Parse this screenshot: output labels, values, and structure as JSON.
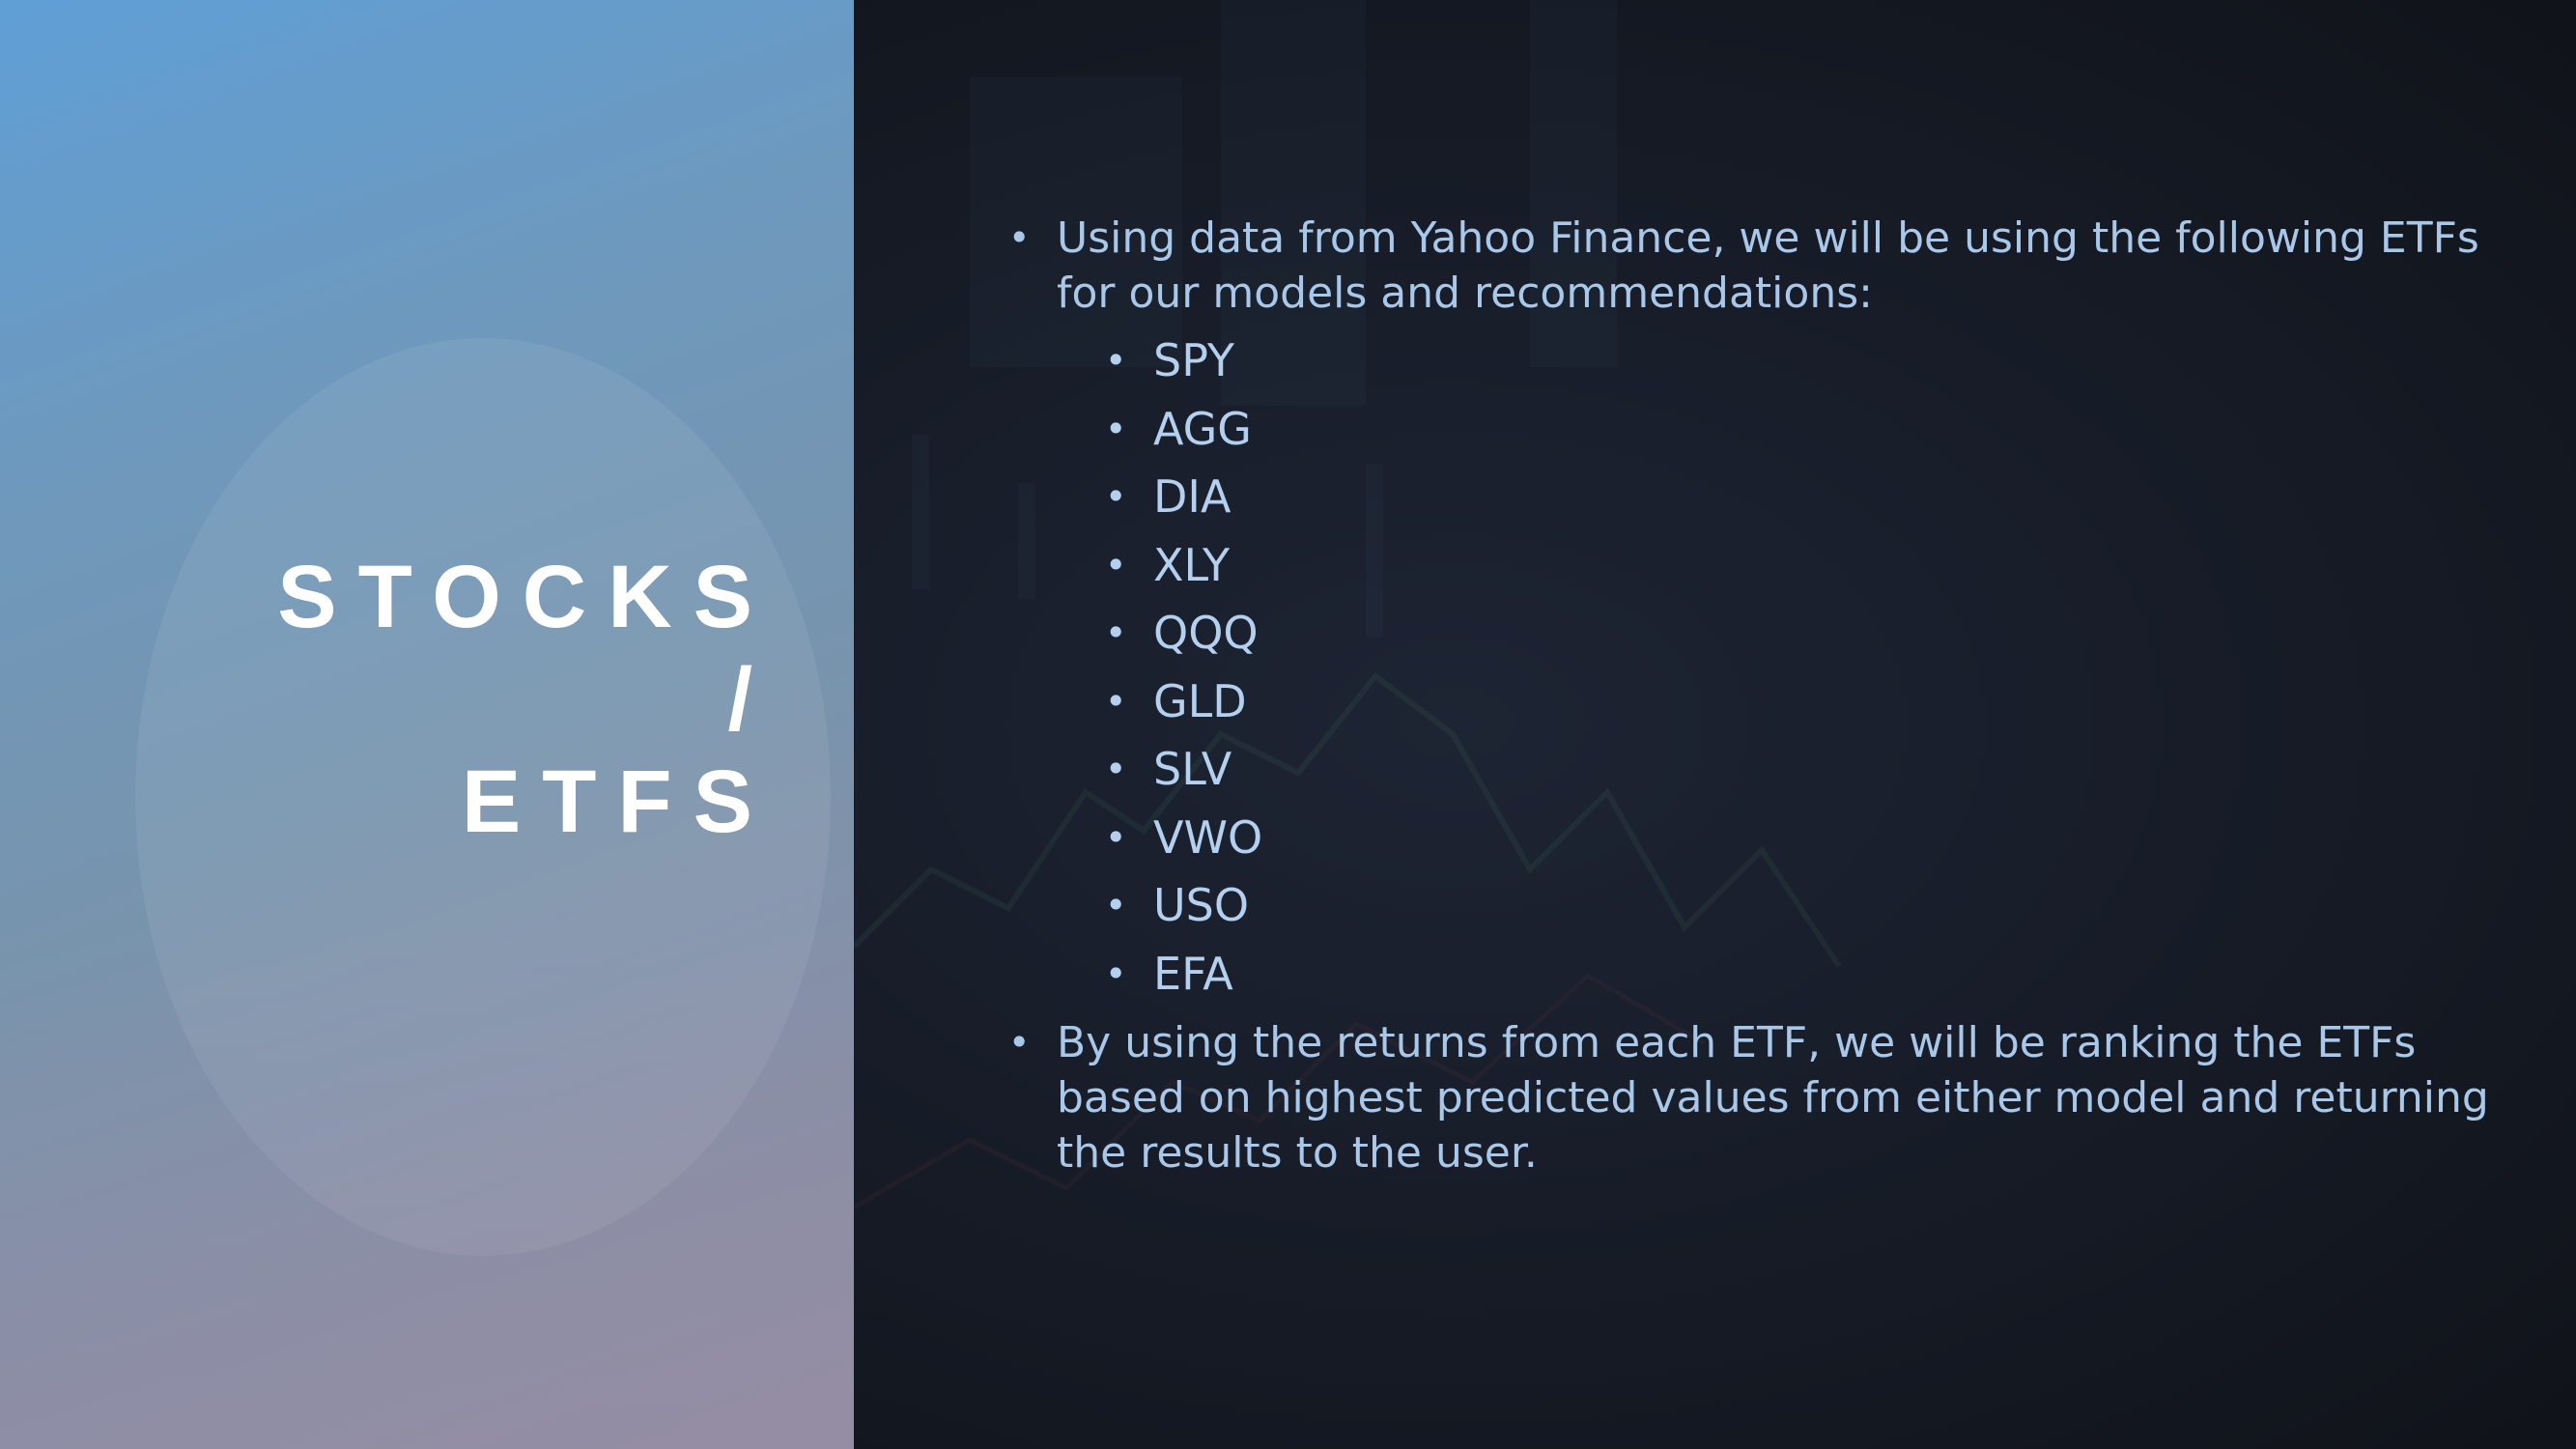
{
  "slide": {
    "title_lines": [
      "STOCKS",
      "/",
      "ETFS"
    ]
  },
  "content": {
    "intro_bullet": "Using data from Yahoo Finance, we will be using the following ETFs for our models and recommendations:",
    "etfs": [
      "SPY",
      "AGG",
      "DIA",
      "XLY",
      "QQQ",
      "GLD",
      "SLV",
      "VWO",
      "USO",
      "EFA"
    ],
    "closing_bullet": "By using the returns from each ETF, we will be ranking the ETFs based on highest predicted values from either model and returning the results to the user."
  },
  "colors": {
    "left_gradient_top": "#5f9fd6",
    "left_gradient_bottom": "#958da3",
    "dark_background": "#161b26",
    "body_text": "#a9c7e8",
    "title_text": "#ffffff"
  }
}
